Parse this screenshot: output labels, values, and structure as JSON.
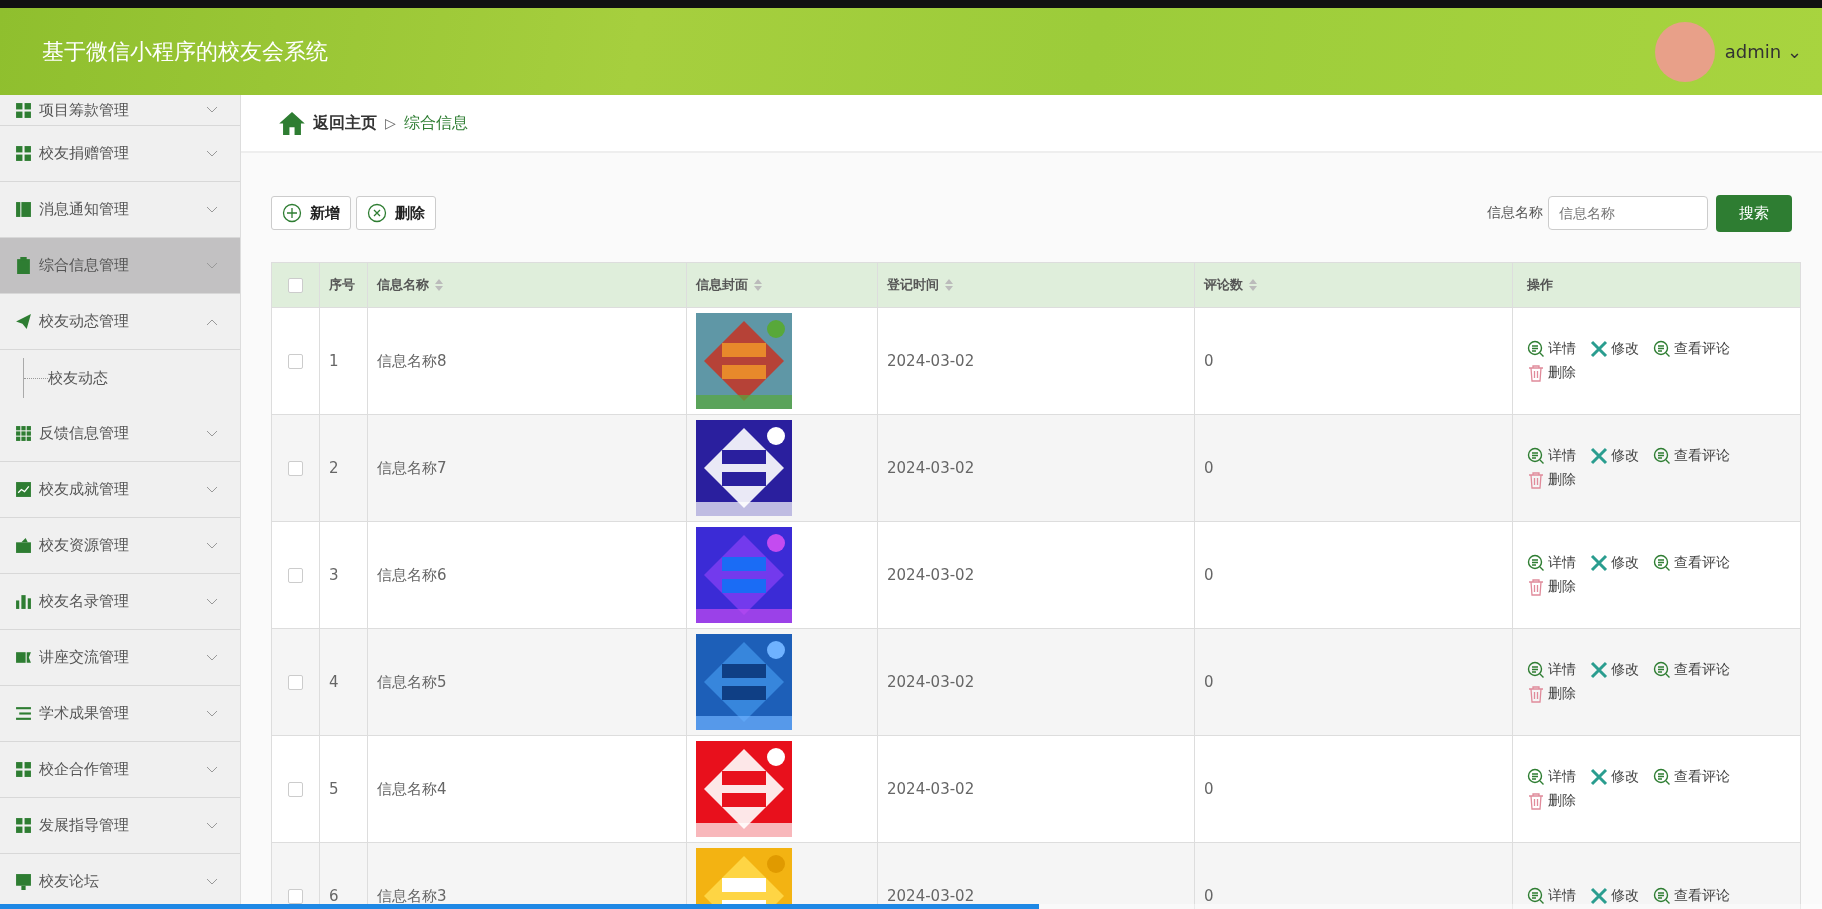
{
  "header": {
    "title": "基于微信小程序的校友会系统",
    "user": "admin",
    "user_caret": "⌄"
  },
  "sidebar": {
    "items": [
      {
        "label": "项目筹款管理",
        "selected": false,
        "expanded": false
      },
      {
        "label": "校友捐赠管理",
        "selected": false,
        "expanded": false
      },
      {
        "label": "消息通知管理",
        "selected": false,
        "expanded": false
      },
      {
        "label": "综合信息管理",
        "selected": true,
        "expanded": false
      },
      {
        "label": "校友动态管理",
        "selected": false,
        "expanded": true,
        "children": [
          {
            "label": "校友动态"
          }
        ]
      },
      {
        "label": "反馈信息管理",
        "selected": false,
        "expanded": false
      },
      {
        "label": "校友成就管理",
        "selected": false,
        "expanded": false
      },
      {
        "label": "校友资源管理",
        "selected": false,
        "expanded": false
      },
      {
        "label": "校友名录管理",
        "selected": false,
        "expanded": false
      },
      {
        "label": "讲座交流管理",
        "selected": false,
        "expanded": false
      },
      {
        "label": "学术成果管理",
        "selected": false,
        "expanded": false
      },
      {
        "label": "校企合作管理",
        "selected": false,
        "expanded": false
      },
      {
        "label": "发展指导管理",
        "selected": false,
        "expanded": false
      },
      {
        "label": "校友论坛",
        "selected": false,
        "expanded": false
      }
    ]
  },
  "breadcrumb": {
    "home": "返回主页",
    "separator": "▷",
    "current": "综合信息"
  },
  "toolbar": {
    "buttons": [
      {
        "kind": "add",
        "label": "新增"
      },
      {
        "kind": "delete",
        "label": "删除"
      }
    ],
    "search_label": "信息名称",
    "search_placeholder": "信息名称",
    "search_button": "搜索"
  },
  "table": {
    "all_checked": false,
    "columns": [
      {
        "label": "序号",
        "sortable": false
      },
      {
        "label": "信息名称",
        "sortable": true
      },
      {
        "label": "信息封面",
        "sortable": true
      },
      {
        "label": "登记时间",
        "sortable": true
      },
      {
        "label": "评论数",
        "sortable": true
      },
      {
        "label": "操作",
        "sortable": false
      }
    ],
    "rows": [
      {
        "checked": false,
        "index": "1",
        "name": "信息名称8",
        "cover": {
          "kind": "picture"
        },
        "date": "2024-03-02",
        "comments": "0",
        "actions": [
          {
            "kind": "detail",
            "label": "详情"
          },
          {
            "kind": "edit",
            "label": "修改"
          },
          {
            "kind": "comments",
            "label": "查看评论"
          },
          {
            "kind": "delete",
            "label": "删除"
          }
        ]
      },
      {
        "checked": false,
        "index": "2",
        "name": "信息名称7",
        "cover": {
          "kind": "picture"
        },
        "date": "2024-03-02",
        "comments": "0",
        "actions": [
          {
            "kind": "detail",
            "label": "详情"
          },
          {
            "kind": "edit",
            "label": "修改"
          },
          {
            "kind": "comments",
            "label": "查看评论"
          },
          {
            "kind": "delete",
            "label": "删除"
          }
        ]
      },
      {
        "checked": false,
        "index": "3",
        "name": "信息名称6",
        "cover": {
          "kind": "picture"
        },
        "date": "2024-03-02",
        "comments": "0",
        "actions": [
          {
            "kind": "detail",
            "label": "详情"
          },
          {
            "kind": "edit",
            "label": "修改"
          },
          {
            "kind": "comments",
            "label": "查看评论"
          },
          {
            "kind": "delete",
            "label": "删除"
          }
        ]
      },
      {
        "checked": false,
        "index": "4",
        "name": "信息名称5",
        "cover": {
          "kind": "picture"
        },
        "date": "2024-03-02",
        "comments": "0",
        "actions": [
          {
            "kind": "detail",
            "label": "详情"
          },
          {
            "kind": "edit",
            "label": "修改"
          },
          {
            "kind": "comments",
            "label": "查看评论"
          },
          {
            "kind": "delete",
            "label": "删除"
          }
        ]
      },
      {
        "checked": false,
        "index": "5",
        "name": "信息名称4",
        "cover": {
          "kind": "picture"
        },
        "date": "2024-03-02",
        "comments": "0",
        "actions": [
          {
            "kind": "detail",
            "label": "详情"
          },
          {
            "kind": "edit",
            "label": "修改"
          },
          {
            "kind": "comments",
            "label": "查看评论"
          },
          {
            "kind": "delete",
            "label": "删除"
          }
        ]
      },
      {
        "checked": false,
        "index": "6",
        "name": "信息名称3",
        "cover": {
          "kind": "picture"
        },
        "date": "2024-03-02",
        "comments": "0",
        "actions": [
          {
            "kind": "detail",
            "label": "详情"
          },
          {
            "kind": "edit",
            "label": "修改"
          },
          {
            "kind": "comments",
            "label": "查看评论"
          }
        ]
      }
    ]
  },
  "video_progress": {
    "level": 0.57
  }
}
